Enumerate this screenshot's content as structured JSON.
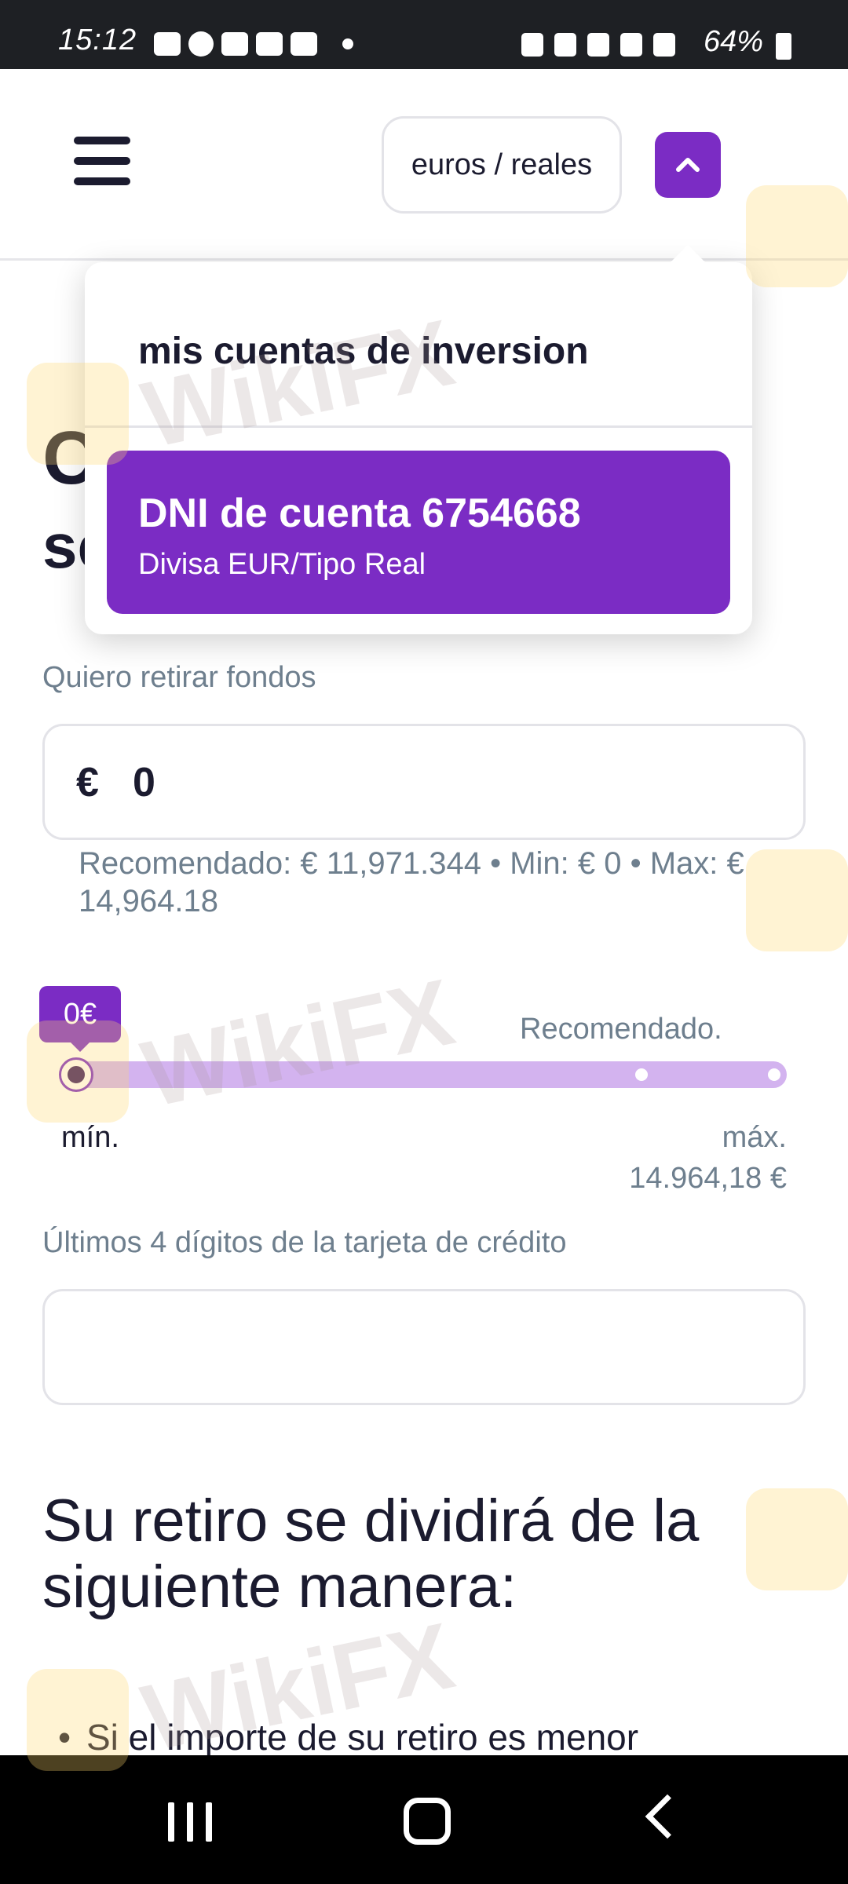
{
  "status_bar": {
    "time": "15:12",
    "battery_pct": "64%",
    "left_icons": [
      "message-icon",
      "messenger-icon",
      "feed-icon",
      "youtube-icon",
      "youtube-icon",
      "dot-icon"
    ],
    "right_icons": [
      "lock-icon",
      "alarm-icon",
      "location-icon",
      "wifi-icon",
      "signal-icon",
      "battery-icon"
    ]
  },
  "header": {
    "account_selector_label": "euros / reales"
  },
  "dropdown": {
    "title": "mis cuentas de inversion",
    "account": {
      "id_label": "DNI de cuenta 6754668",
      "detail": "Divisa EUR/Tipo Real"
    }
  },
  "page": {
    "title_partial": "C\nse"
  },
  "withdraw": {
    "label": "Quiero retirar fondos",
    "currency_symbol": "€",
    "amount_value": "0",
    "hint": "Recomendado: € 11,971.344 • Min: € 0 • Max: € 14,964.18"
  },
  "slider": {
    "bubble_label": "0€",
    "recommended_label": "Recomendado.",
    "min_label": "mín.",
    "max_label": "máx.",
    "max_value": "14.964,18 €",
    "value_fraction": 0.0,
    "recommended_fraction": 0.8,
    "max_fraction": 1.0
  },
  "card": {
    "label": "Últimos 4 dígitos de la tarjeta de crédito",
    "value": ""
  },
  "split": {
    "title": "Su retiro se dividirá de la siguiente manera:",
    "bullet_1": "Si el importe de su retiro es menor"
  },
  "watermark": {
    "text": "WikiFX"
  },
  "colors": {
    "accent": "#7b2cc4",
    "track": "#d3b3ef",
    "muted_text": "#6e7f8e"
  }
}
